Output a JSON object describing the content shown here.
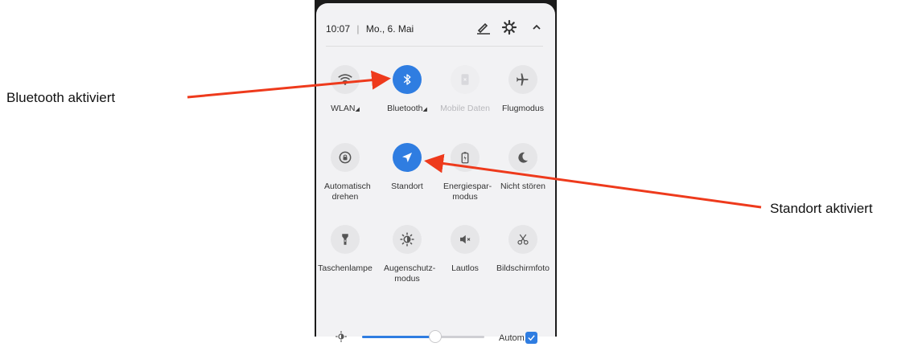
{
  "status_bar": {
    "time": "10:07",
    "separator": "|",
    "date": "Mo., 6. Mai",
    "icons": [
      "edit-icon",
      "settings-icon",
      "collapse-icon"
    ]
  },
  "tiles": [
    {
      "label": "WLAN",
      "icon": "wifi-icon",
      "state": "inactive",
      "has_dropdown": true
    },
    {
      "label": "Bluetooth",
      "icon": "bluetooth-icon",
      "state": "active",
      "has_dropdown": true
    },
    {
      "label": "Mobile Daten",
      "icon": "mobile-data-icon",
      "state": "disabled"
    },
    {
      "label": "Flugmodus",
      "icon": "airplane-icon",
      "state": "inactive"
    },
    {
      "label": "Automatisch drehen",
      "icon": "auto-rotate-icon",
      "state": "inactive"
    },
    {
      "label": "Standort",
      "icon": "location-icon",
      "state": "active"
    },
    {
      "label": "Energiespar-modus",
      "icon": "battery-saver-icon",
      "state": "inactive"
    },
    {
      "label": "Nicht stören",
      "icon": "moon-icon",
      "state": "inactive"
    },
    {
      "label": "Taschenlampe",
      "icon": "flashlight-icon",
      "state": "inactive"
    },
    {
      "label": "Augenschutz-modus",
      "icon": "eye-comfort-icon",
      "state": "inactive"
    },
    {
      "label": "Lautlos",
      "icon": "mute-icon",
      "state": "inactive"
    },
    {
      "label": "Bildschirmfoto",
      "icon": "screenshot-icon",
      "state": "inactive"
    }
  ],
  "brightness": {
    "level": 0.6,
    "auto_label": "Autom.",
    "auto_checked": true
  },
  "annotations": {
    "bluetooth": "Bluetooth aktiviert",
    "location": "Standort aktiviert"
  },
  "colors": {
    "accent": "#2f7de1",
    "arrow": "#ee3a1c",
    "panel": "#f2f2f4"
  }
}
